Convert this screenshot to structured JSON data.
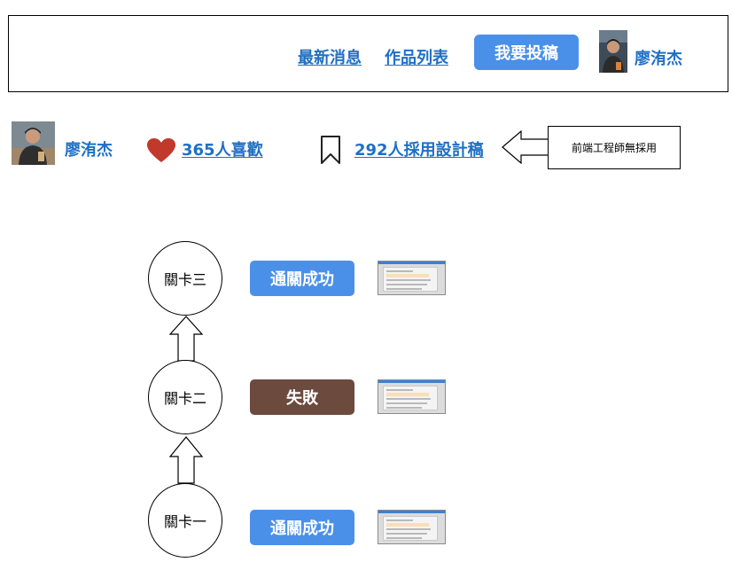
{
  "header": {
    "nav": [
      {
        "label": "最新消息"
      },
      {
        "label": "作品列表"
      }
    ],
    "submit_label": "我要投稿",
    "user_name": "廖洧杰"
  },
  "stats": {
    "author_name": "廖洧杰",
    "likes_label": "365人喜歡",
    "adoptions_label": "292人採用設計稿",
    "note": "前端工程師無採用",
    "heart_color": "#c0392b"
  },
  "levels": [
    {
      "name": "關卡三",
      "status": "通關成功",
      "status_color": "#4a90e8"
    },
    {
      "name": "關卡二",
      "status": "失敗",
      "status_color": "#6d4a3e"
    },
    {
      "name": "關卡一",
      "status": "通關成功",
      "status_color": "#4a90e8"
    }
  ]
}
